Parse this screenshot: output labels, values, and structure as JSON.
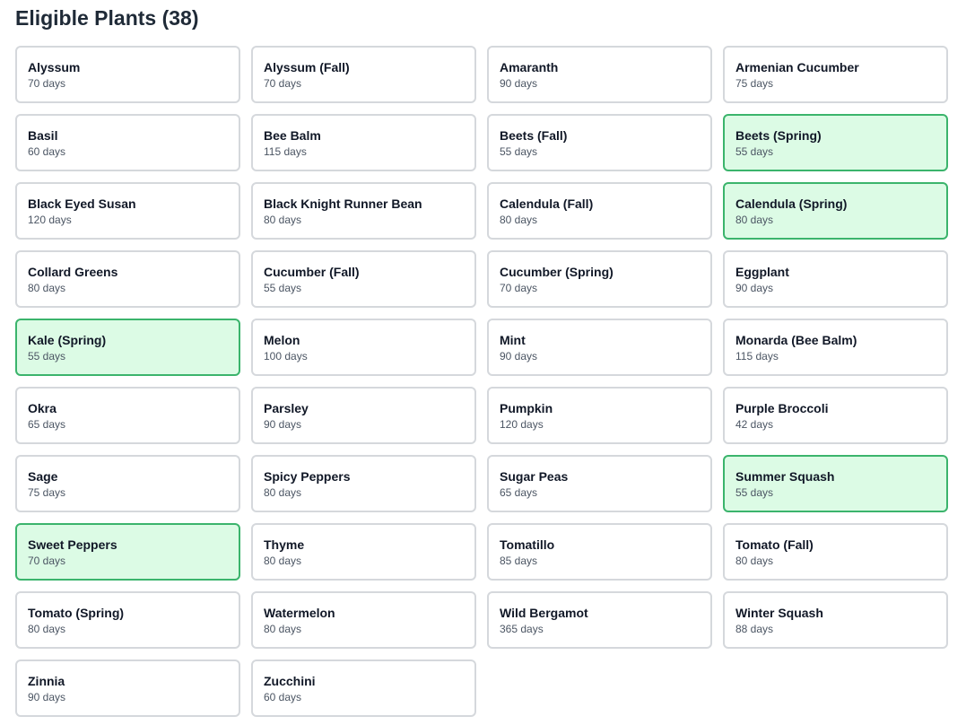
{
  "header": {
    "title": "Eligible Plants (38)"
  },
  "colors": {
    "selected_border": "#3bb46c",
    "selected_background": "#dcfbe5",
    "default_border": "#d5d8dc"
  },
  "plants": [
    {
      "name": "Alyssum",
      "days": "70 days",
      "selected": false
    },
    {
      "name": "Alyssum (Fall)",
      "days": "70 days",
      "selected": false
    },
    {
      "name": "Amaranth",
      "days": "90 days",
      "selected": false
    },
    {
      "name": "Armenian Cucumber",
      "days": "75 days",
      "selected": false
    },
    {
      "name": "Basil",
      "days": "60 days",
      "selected": false
    },
    {
      "name": "Bee Balm",
      "days": "115 days",
      "selected": false
    },
    {
      "name": "Beets (Fall)",
      "days": "55 days",
      "selected": false
    },
    {
      "name": "Beets (Spring)",
      "days": "55 days",
      "selected": true
    },
    {
      "name": "Black Eyed Susan",
      "days": "120 days",
      "selected": false
    },
    {
      "name": "Black Knight Runner Bean",
      "days": "80 days",
      "selected": false
    },
    {
      "name": "Calendula (Fall)",
      "days": "80 days",
      "selected": false
    },
    {
      "name": "Calendula (Spring)",
      "days": "80 days",
      "selected": true
    },
    {
      "name": "Collard Greens",
      "days": "80 days",
      "selected": false
    },
    {
      "name": "Cucumber (Fall)",
      "days": "55 days",
      "selected": false
    },
    {
      "name": "Cucumber (Spring)",
      "days": "70 days",
      "selected": false
    },
    {
      "name": "Eggplant",
      "days": "90 days",
      "selected": false
    },
    {
      "name": "Kale (Spring)",
      "days": "55 days",
      "selected": true
    },
    {
      "name": "Melon",
      "days": "100 days",
      "selected": false
    },
    {
      "name": "Mint",
      "days": "90 days",
      "selected": false
    },
    {
      "name": "Monarda (Bee Balm)",
      "days": "115 days",
      "selected": false
    },
    {
      "name": "Okra",
      "days": "65 days",
      "selected": false
    },
    {
      "name": "Parsley",
      "days": "90 days",
      "selected": false
    },
    {
      "name": "Pumpkin",
      "days": "120 days",
      "selected": false
    },
    {
      "name": "Purple Broccoli",
      "days": "42 days",
      "selected": false
    },
    {
      "name": "Sage",
      "days": "75 days",
      "selected": false
    },
    {
      "name": "Spicy Peppers",
      "days": "80 days",
      "selected": false
    },
    {
      "name": "Sugar Peas",
      "days": "65 days",
      "selected": false
    },
    {
      "name": "Summer Squash",
      "days": "55 days",
      "selected": true
    },
    {
      "name": "Sweet Peppers",
      "days": "70 days",
      "selected": true
    },
    {
      "name": "Thyme",
      "days": "80 days",
      "selected": false
    },
    {
      "name": "Tomatillo",
      "days": "85 days",
      "selected": false
    },
    {
      "name": "Tomato (Fall)",
      "days": "80 days",
      "selected": false
    },
    {
      "name": "Tomato (Spring)",
      "days": "80 days",
      "selected": false
    },
    {
      "name": "Watermelon",
      "days": "80 days",
      "selected": false
    },
    {
      "name": "Wild Bergamot",
      "days": "365 days",
      "selected": false
    },
    {
      "name": "Winter Squash",
      "days": "88 days",
      "selected": false
    },
    {
      "name": "Zinnia",
      "days": "90 days",
      "selected": false
    },
    {
      "name": "Zucchini",
      "days": "60 days",
      "selected": false
    }
  ]
}
